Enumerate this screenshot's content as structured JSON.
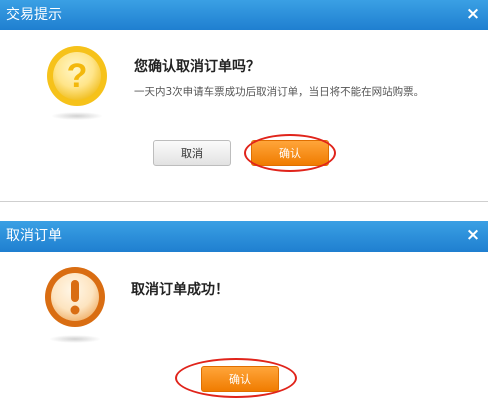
{
  "dialog_confirm": {
    "title": "交易提示",
    "close_glyph": "×",
    "icon": "question-icon",
    "heading": "您确认取消订单吗？",
    "message": "一天内3次申请车票成功后取消订单，当日将不能在网站购票。",
    "cancel_label": "取消",
    "confirm_label": "确认"
  },
  "dialog_success": {
    "title": "取消订单",
    "close_glyph": "×",
    "icon": "exclamation-icon",
    "heading": "取消订单成功！",
    "confirm_label": "确认"
  },
  "colors": {
    "titlebar": "#2a8fdb",
    "confirm_button": "#f58a13",
    "annotation": "#e0241b",
    "question_icon": "#f6c21a",
    "exclamation_icon": "#d96d12"
  }
}
